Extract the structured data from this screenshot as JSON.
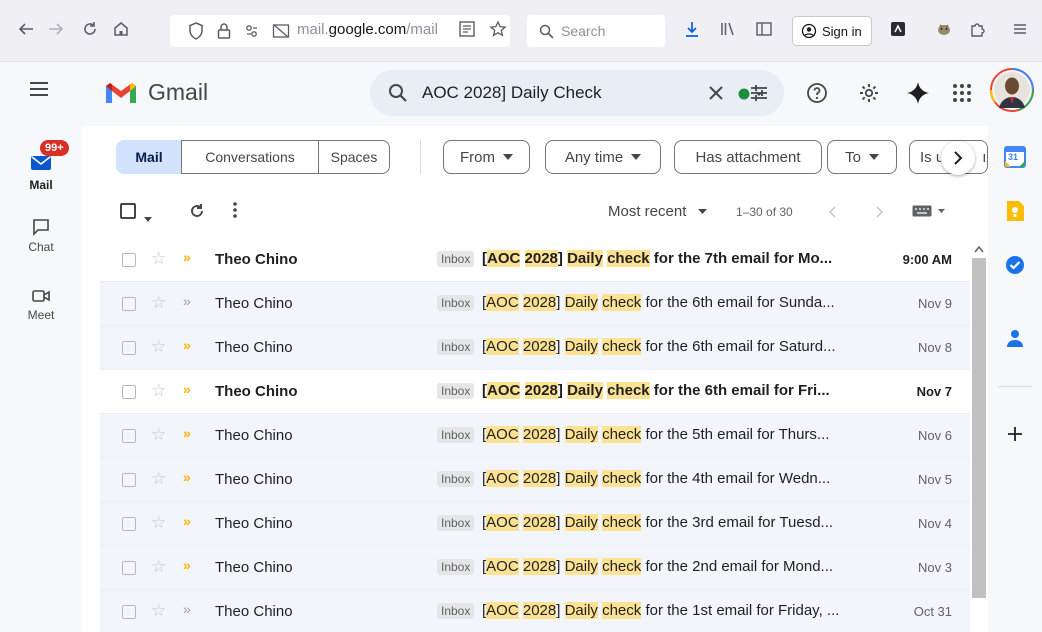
{
  "browser": {
    "url_prefix": "mail.",
    "url_domain": "google.com",
    "url_path": "/mail",
    "search_placeholder": "Search",
    "signin_label": "Sign in"
  },
  "rail": {
    "badge": "99+",
    "items": [
      {
        "label": "Mail",
        "icon": "mail-icon"
      },
      {
        "label": "Chat",
        "icon": "chat-icon"
      },
      {
        "label": "Meet",
        "icon": "meet-icon"
      }
    ]
  },
  "header": {
    "app_name": "Gmail",
    "search_query": "AOC 2028] Daily Check",
    "status_color": "#1e8e3e"
  },
  "chips": {
    "segments": [
      "Mail",
      "Conversations",
      "Spaces"
    ],
    "filters": [
      "From",
      "Any time",
      "Has attachment",
      "To",
      "Is u"
    ],
    "partial_text": "ıc"
  },
  "toolbar": {
    "sort_label": "Most recent",
    "range": "1–30 of 30"
  },
  "emails": [
    {
      "sender": "Theo Chino",
      "tag": "Inbox",
      "subject_rest": " for the 7th email for Mo...",
      "date": "9:00 AM",
      "unread": true,
      "important": true
    },
    {
      "sender": "Theo Chino",
      "tag": "Inbox",
      "subject_rest": " for the 6th email for Sunda...",
      "date": "Nov 9",
      "unread": false,
      "important": false
    },
    {
      "sender": "Theo Chino",
      "tag": "Inbox",
      "subject_rest": " for the 6th email for Saturd...",
      "date": "Nov 8",
      "unread": false,
      "important": true
    },
    {
      "sender": "Theo Chino",
      "tag": "Inbox",
      "subject_rest": " for the 6th email for Fri...",
      "date": "Nov 7",
      "unread": true,
      "important": true
    },
    {
      "sender": "Theo Chino",
      "tag": "Inbox",
      "subject_rest": " for the 5th email for Thurs...",
      "date": "Nov 6",
      "unread": false,
      "important": true
    },
    {
      "sender": "Theo Chino",
      "tag": "Inbox",
      "subject_rest": " for the 4th email for Wedn...",
      "date": "Nov 5",
      "unread": false,
      "important": true
    },
    {
      "sender": "Theo Chino",
      "tag": "Inbox",
      "subject_rest": " for the 3rd email for Tuesd...",
      "date": "Nov 4",
      "unread": false,
      "important": true
    },
    {
      "sender": "Theo Chino",
      "tag": "Inbox",
      "subject_rest": " for the 2nd email for Mond...",
      "date": "Nov 3",
      "unread": false,
      "important": true
    },
    {
      "sender": "Theo Chino",
      "tag": "Inbox",
      "subject_rest": " for the 1st email for Friday, ...",
      "date": "Oct 31",
      "unread": false,
      "important": false
    }
  ],
  "subject_parts": {
    "open": "[",
    "aoc": "AOC",
    "year": "2028",
    "close": "] ",
    "daily": "Daily",
    "check": "check"
  },
  "side_panel": {
    "icons": [
      "calendar-icon",
      "keep-icon",
      "tasks-icon",
      "contacts-icon",
      "add-icon"
    ],
    "calendar_day": "31"
  }
}
